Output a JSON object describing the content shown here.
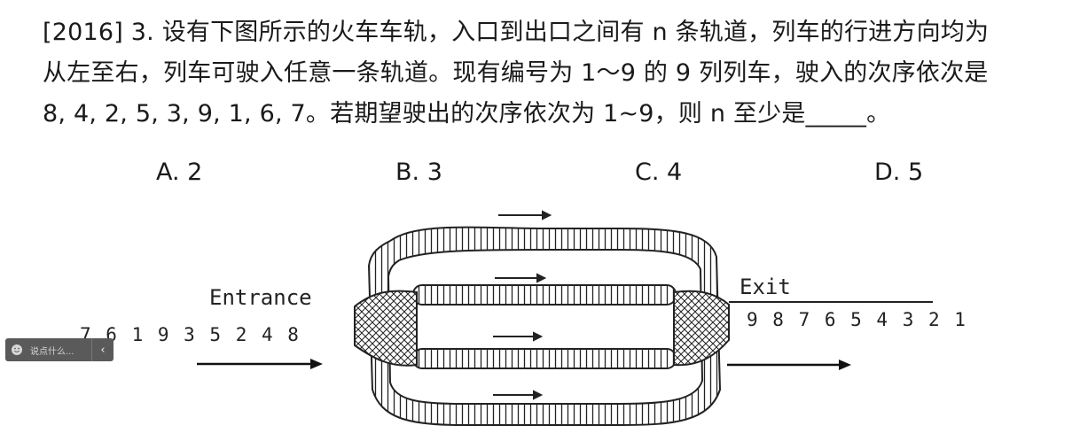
{
  "question": {
    "line1": "[2016] 3. 设有下图所示的火车车轨，入口到出口之间有 n 条轨道，列车的行进方向均为",
    "line2": "从左至右，列车可驶入任意一条轨道。现有编号为 1～9 的 9 列列车，驶入的次序依次是",
    "line3": "8, 4, 2, 5, 3, 9, 1, 6, 7。若期望驶出的次序依次为 1~9，则 n 至少是_____。"
  },
  "options": {
    "a": "A. 2",
    "b": "B. 3",
    "c": "C. 4",
    "d": "D. 5"
  },
  "diagram": {
    "entrance_label": "Entrance",
    "exit_label": "Exit",
    "entrance_sequence": "7 6 1 9 3 5 2 4 8",
    "exit_sequence": "9 8 7 6 5 4 3 2 1"
  },
  "comment_widget": {
    "placeholder": "说点什么...",
    "icon": "smile-icon",
    "collapse_icon": "chevron-left-icon",
    "background": "#5a5a5a"
  }
}
